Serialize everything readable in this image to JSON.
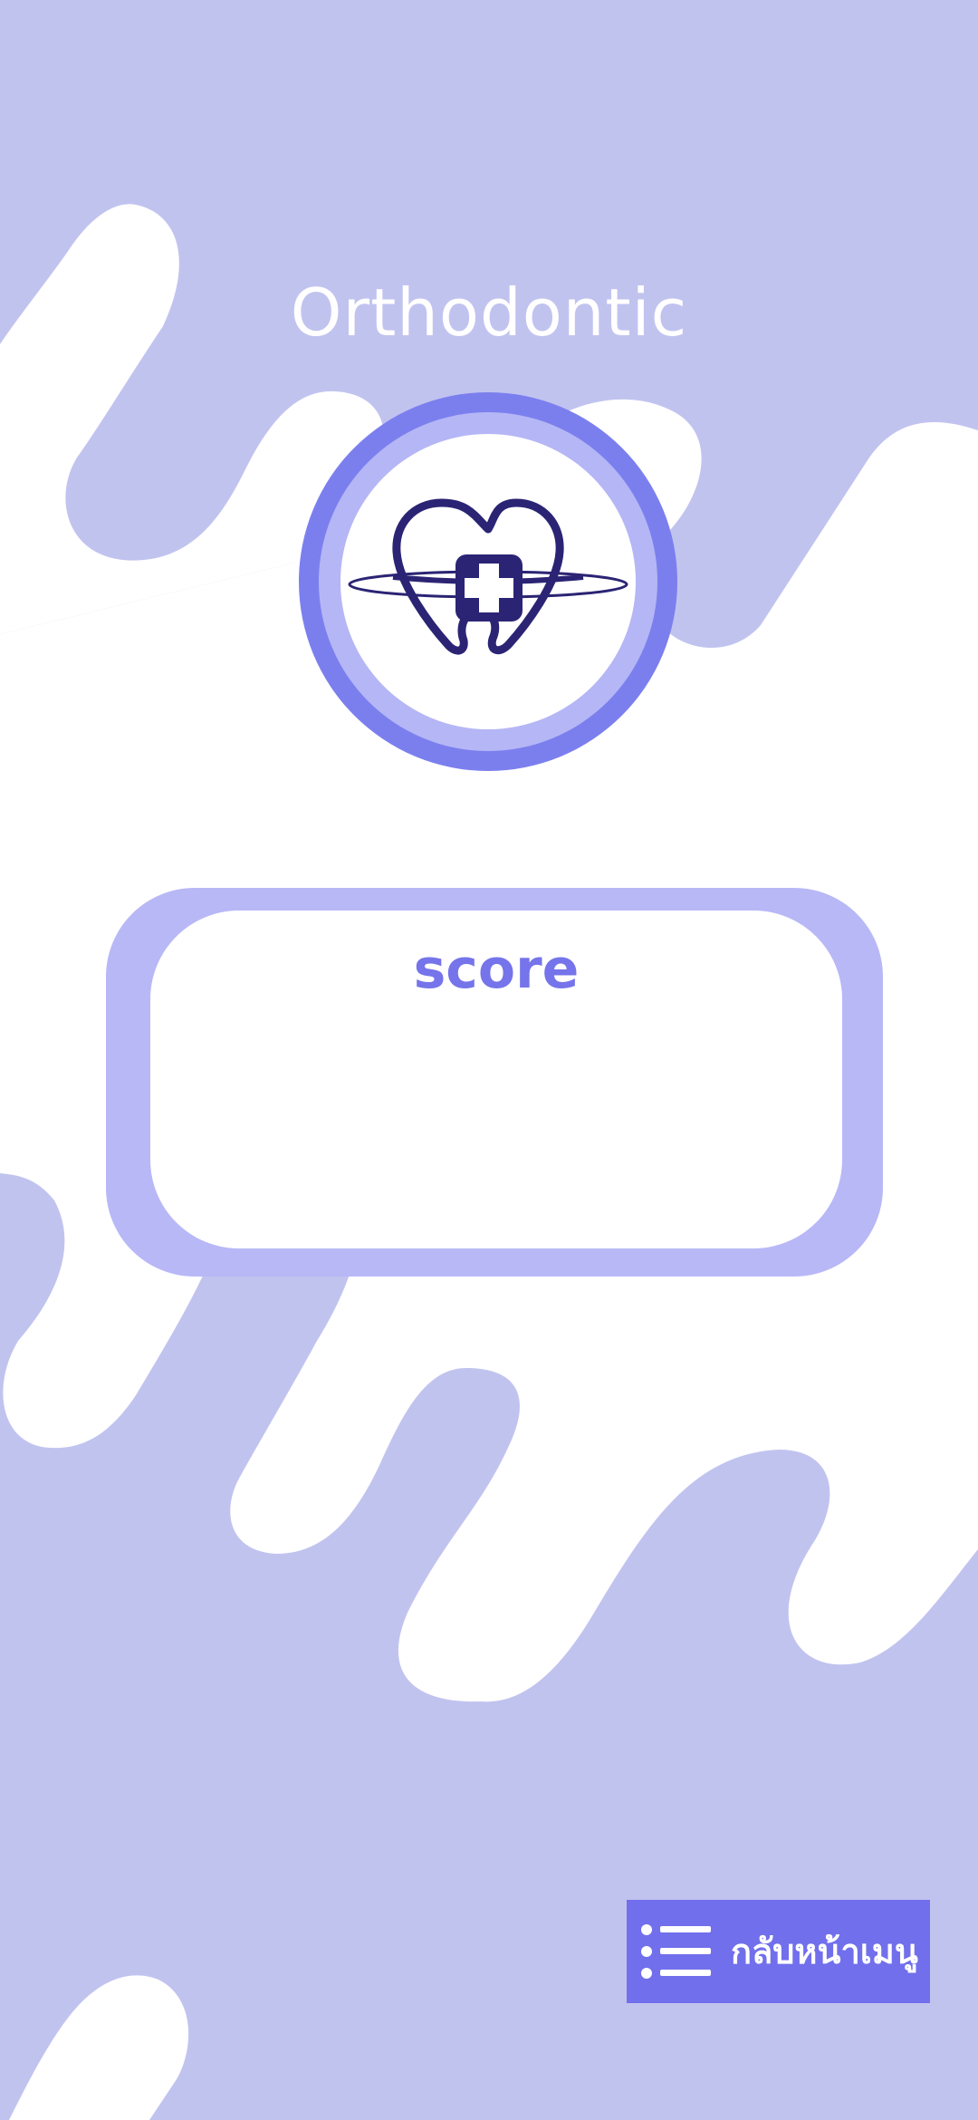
{
  "app": {
    "title": "Orthodontic"
  },
  "logo": {
    "icon": "tooth-heart-cross-icon"
  },
  "score": {
    "label": "score",
    "value": ""
  },
  "menu_button": {
    "label": "กลับหน้าเมนู",
    "icon": "list-icon"
  },
  "colors": {
    "background": "#c1c3ef",
    "accent": "#716fec",
    "ring": "#7b7fee",
    "ring_light": "#b5b6f5",
    "card": "#b8b8f7",
    "logo_navy": "#2b2474"
  }
}
